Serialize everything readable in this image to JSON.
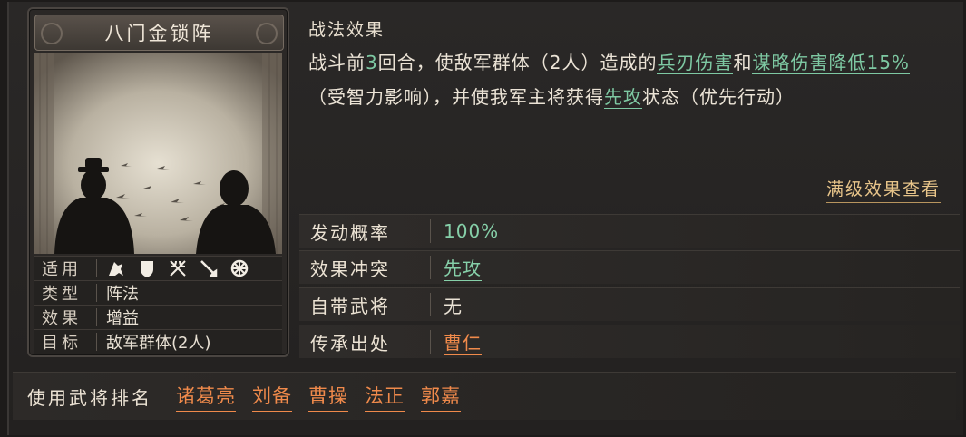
{
  "card": {
    "title": "八门金锁阵",
    "rows": [
      {
        "key": "适用",
        "icons": [
          "cavalry-icon",
          "shield-icon",
          "crossed-bows-icon",
          "spear-icon",
          "wheel-icon"
        ]
      },
      {
        "key": "类型",
        "value": "阵法"
      },
      {
        "key": "效果",
        "value": "增益"
      },
      {
        "key": "目标",
        "value": "敌军群体(2人)"
      }
    ]
  },
  "effect": {
    "heading": "战法效果",
    "p1": "战斗前",
    "num": "3",
    "p2": "回合，使敌军群体（2人）造成的",
    "hl1": "兵刃伤害",
    "p3": "和",
    "hl2": "谋略伤害降低15%",
    "p4": "（受智力影响），并使我军主将获得",
    "hl3": "先攻",
    "p5": "状态（优先行动）",
    "full_button": "满级效果查看"
  },
  "attributes": [
    {
      "key": "发动概率",
      "value": "100%",
      "style": "green"
    },
    {
      "key": "效果冲突",
      "value": "先攻",
      "style": "green-ul"
    },
    {
      "key": "自带武将",
      "value": "无",
      "style": "white"
    },
    {
      "key": "传承出处",
      "value": "曹仁",
      "style": "orange"
    }
  ],
  "ranking": {
    "label": "使用武将排名",
    "names": [
      "诸葛亮",
      "刘备",
      "曹操",
      "法正",
      "郭嘉"
    ]
  },
  "colors": {
    "highlight_green": "#7ec9a3",
    "accent_orange": "#f08a4b",
    "gold": "#e8c58a"
  }
}
